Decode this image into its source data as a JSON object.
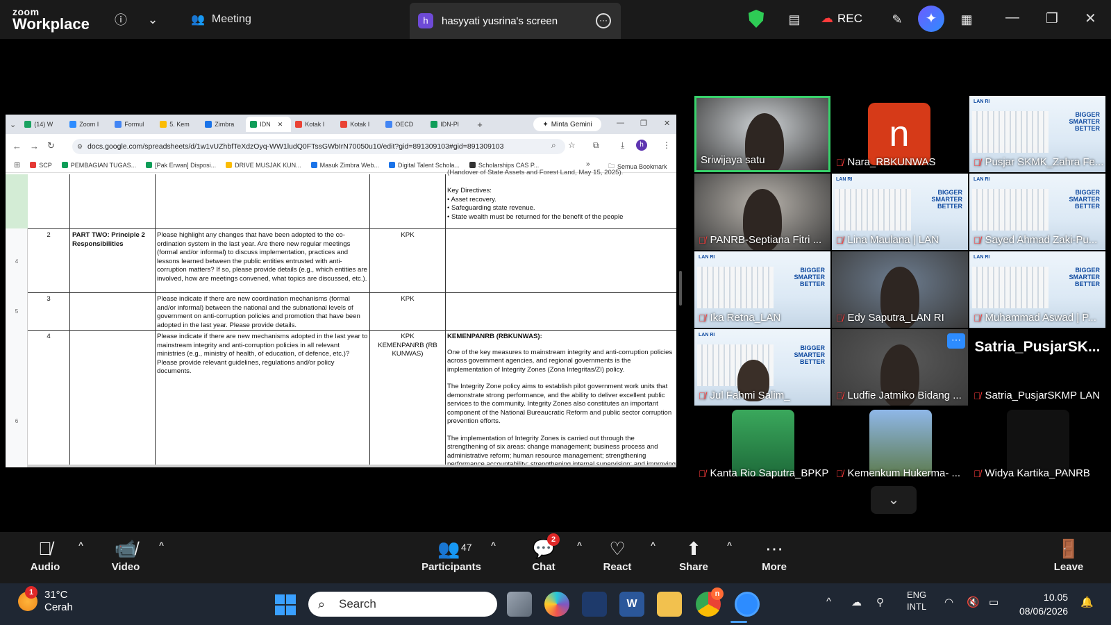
{
  "topbar": {
    "logo_line1": "zoom",
    "logo_line2": "Workplace",
    "meeting_label": "Meeting",
    "screen_share_label": "hasyyati yusrina's screen",
    "screen_share_initial": "h",
    "rec_label": "REC"
  },
  "browser": {
    "tabs": [
      {
        "label": "(14) W",
        "color": "#1aa260"
      },
      {
        "label": "Zoom I",
        "color": "#2d8cff"
      },
      {
        "label": "Formul",
        "color": "#4285f4"
      },
      {
        "label": "5. Kem",
        "color": "#fbbc04"
      },
      {
        "label": "Zimbra",
        "color": "#1a73e8"
      },
      {
        "label": "IDN",
        "color": "#0f9d58",
        "active": true
      },
      {
        "label": "Kotak I",
        "color": "#ea4335"
      },
      {
        "label": "Kotak I",
        "color": "#ea4335"
      },
      {
        "label": "OECD",
        "color": "#4285f4"
      },
      {
        "label": "IDN-Pl",
        "color": "#0f9d58"
      }
    ],
    "gemini_label": "Minta Gemini",
    "url": "docs.google.com/spreadsheets/d/1w1vUZhbfTeXdzOyq-WW1ludQ0FTssGWbIrN70050u10/edit?gid=891309103#gid=891309103",
    "profile_initial": "h",
    "bookmarks": [
      {
        "label": "SCP",
        "color": "#e53935"
      },
      {
        "label": "PEMBAGIAN TUGAS...",
        "color": "#0f9d58"
      },
      {
        "label": "[Pak Erwan] Disposi...",
        "color": "#0f9d58"
      },
      {
        "label": "DRIVE MUSJAK KUN...",
        "color": "#fbbc04"
      },
      {
        "label": "Masuk Zimbra Web...",
        "color": "#1a73e8"
      },
      {
        "label": "Digital Talent Schola...",
        "color": "#1a73e8"
      },
      {
        "label": "Scholarships CAS P...",
        "color": "#333"
      }
    ],
    "all_bookmarks_label": "Semua Bookmark"
  },
  "sheet": {
    "row_numbers": [
      "4",
      "5",
      "6"
    ],
    "top_fragment": "(Handover of State Assets and Forest Land, May 15, 2025).",
    "key_directives_title": "Key Directives:",
    "key_directives": [
      "• Asset recovery.",
      "• Safeguarding state revenue.",
      "• State wealth must be returned for the benefit of the people"
    ],
    "rows": [
      {
        "no": "2",
        "part": "PART TWO: Principle 2 Responsibilities",
        "question": "Please highlight any changes that have been adopted to the co-ordination system in the last year. Are there new regular meetings (formal and/or informal) to discuss implementation, practices and lessons learned between the public entities entrusted with anti-corruption matters? If so, please provide details (e.g., which entities are involved, how are meetings convened, what topics are discussed, etc.).",
        "agency": "KPK",
        "answer": ""
      },
      {
        "no": "3",
        "part": "",
        "question": "Please indicate if there are new coordination mechanisms (formal and/or informal) between the national and the subnational levels of government on anti-corruption policies and promotion that have been adopted in the last year. Please provide details.",
        "agency": "KPK",
        "answer": ""
      },
      {
        "no": "4",
        "part": "",
        "question": "Please indicate if there are new mechanisms adopted in the last year to mainstream integrity and anti-corruption policies in all relevant ministries (e.g., ministry of health, of education, of defence, etc.)? Please provide relevant guidelines, regulations and/or policy documents.",
        "agency": "KPK\nKEMENPANRB (RB KUNWAS)",
        "answer_title": "KEMENPANRB (RBKUNWAS):",
        "answer_p1": "One of the key measures to mainstream integrity and anti-corruption policies across government agencies, and regional governments is the implementation of Integrity Zones (Zona Integritas/ZI) policy.",
        "answer_p2": "The Integrity Zone policy aims to establish pilot government work units that demonstrate strong performance, and the ability to deliver excellent public services to the community. Integrity Zones also constitutes an important component of the National Bureaucratic Reform and public sector corruption prevention efforts.",
        "answer_p3": "The implementation of Integrity Zones is carried out through the strengthening of six areas: change management; business process and administrative reform; human resource management; strengthening performance accountability; strengthening internal supervision; and improving public service delivery."
      }
    ]
  },
  "participants": [
    {
      "name": "Sriwijaya satu",
      "muted": false,
      "type": "camera",
      "active": true
    },
    {
      "name": "Nara_RBKUNWAS",
      "muted": true,
      "type": "initial",
      "initial": "n"
    },
    {
      "name": "Pusjar SKMK_Zahra Fe...",
      "muted": true,
      "type": "poster"
    },
    {
      "name": "PANRB-Septiana Fitri ...",
      "muted": true,
      "type": "camera"
    },
    {
      "name": "Lina Maulana | LAN",
      "muted": true,
      "type": "poster"
    },
    {
      "name": "Sayed Ahmad Zaki-Pu...",
      "muted": true,
      "type": "poster"
    },
    {
      "name": "Ika Retna_LAN",
      "muted": true,
      "type": "poster"
    },
    {
      "name": "Edy Saputra_LAN RI",
      "muted": true,
      "type": "camera"
    },
    {
      "name": "Muhammad Aswad | P...",
      "muted": true,
      "type": "poster"
    },
    {
      "name": "Jul Fahmi Salim_",
      "muted": true,
      "type": "poster"
    },
    {
      "name": "Ludfie Jatmiko Bidang ...",
      "muted": true,
      "type": "camera"
    },
    {
      "name": "Satria_PusjarSKMP LAN",
      "muted": true,
      "type": "name",
      "display": "Satria_PusjarSK..."
    },
    {
      "name": "Kanta Rio Saputra_BPKP",
      "muted": true,
      "type": "picture"
    },
    {
      "name": "Kemenkum Hukerma- ...",
      "muted": true,
      "type": "picture"
    },
    {
      "name": "Widya Kartika_PANRB",
      "muted": true,
      "type": "picture"
    }
  ],
  "poster": {
    "slogan_line1": "BIGGER",
    "slogan_line2": "SMARTER",
    "slogan_line3": "BETTER",
    "lan": "LAN RI"
  },
  "toolbar": {
    "audio": "Audio",
    "video": "Video",
    "participants": "Participants",
    "participants_count": "47",
    "chat": "Chat",
    "chat_badge": "2",
    "react": "React",
    "share": "Share",
    "more": "More",
    "leave": "Leave"
  },
  "taskbar": {
    "weather_badge": "1",
    "temperature": "31°C",
    "weather_desc": "Cerah",
    "search_placeholder": "Search",
    "chrome_badge": "n",
    "lang_line1": "ENG",
    "lang_line2": "INTL",
    "time": "10.05",
    "date": "08/06/2026"
  }
}
